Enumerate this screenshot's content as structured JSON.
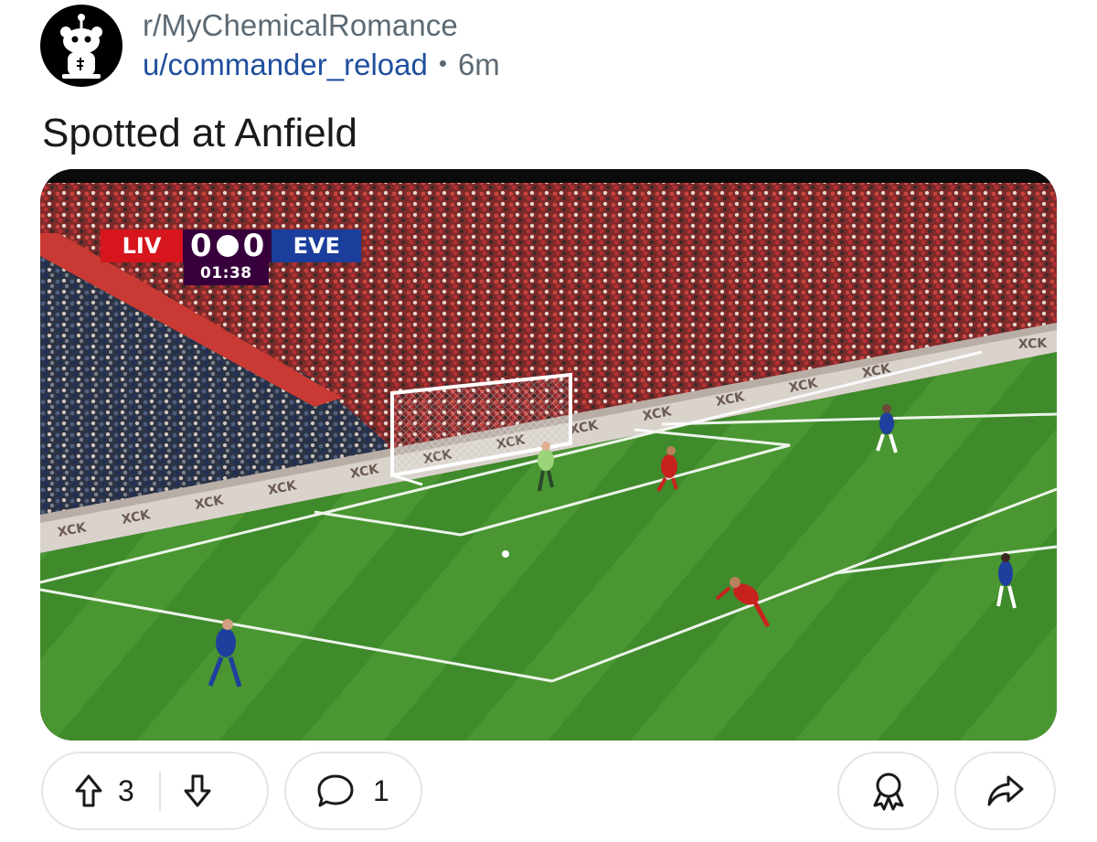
{
  "post": {
    "subreddit": "r/MyChemicalRomance",
    "author": "u/commander_reload",
    "separator": "•",
    "age": "6m",
    "title": "Spotted at Anfield",
    "avatar_icon": "snoo-avatar-icon"
  },
  "media": {
    "scoreboard": {
      "home_team": "LIV",
      "home_score": "0",
      "away_score": "0",
      "away_team": "EVE",
      "clock": "01:38"
    }
  },
  "actions": {
    "upvote_count": "3",
    "comment_count": "1",
    "icons": [
      "upvote-icon",
      "downvote-icon",
      "comment-icon",
      "award-icon",
      "share-icon"
    ]
  },
  "colors": {
    "subreddit_text": "#5c6a74",
    "author_link": "#1f4f9e",
    "pitch_green": "#3f8a2a",
    "home_team_red": "#d7151d",
    "away_team_blue": "#1b3e9c",
    "scoreboard_purple": "#37003c"
  }
}
